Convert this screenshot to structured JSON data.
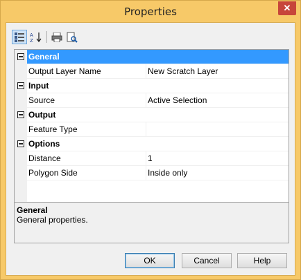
{
  "window": {
    "title": "Properties",
    "close_glyph": "✕"
  },
  "toolbar": {
    "buttons": [
      {
        "name": "categorized-view",
        "icon": "categorized-icon",
        "active": true
      },
      {
        "name": "alphabetical-sort",
        "icon": "sort-az-icon",
        "label": "A↓Z"
      },
      {
        "name": "print",
        "icon": "print-icon"
      },
      {
        "name": "print-preview",
        "icon": "print-preview-icon"
      }
    ]
  },
  "grid": {
    "categories": [
      {
        "label": "General",
        "selected": true,
        "properties": [
          {
            "name": "Output Layer Name",
            "value": "New Scratch Layer"
          }
        ]
      },
      {
        "label": "Input",
        "properties": [
          {
            "name": "Source",
            "value": "Active Selection"
          }
        ]
      },
      {
        "label": "Output",
        "properties": [
          {
            "name": "Feature Type",
            "value": ""
          }
        ]
      },
      {
        "label": "Options",
        "properties": [
          {
            "name": "Distance",
            "value": "1"
          },
          {
            "name": "Polygon Side",
            "value": "Inside only"
          }
        ]
      }
    ]
  },
  "help": {
    "title": "General",
    "description": "General properties."
  },
  "buttons": {
    "ok": "OK",
    "cancel": "Cancel",
    "help": "Help"
  },
  "colors": {
    "title_bar": "#f7c968",
    "selection": "#3399ff",
    "close_button": "#c7463a"
  }
}
